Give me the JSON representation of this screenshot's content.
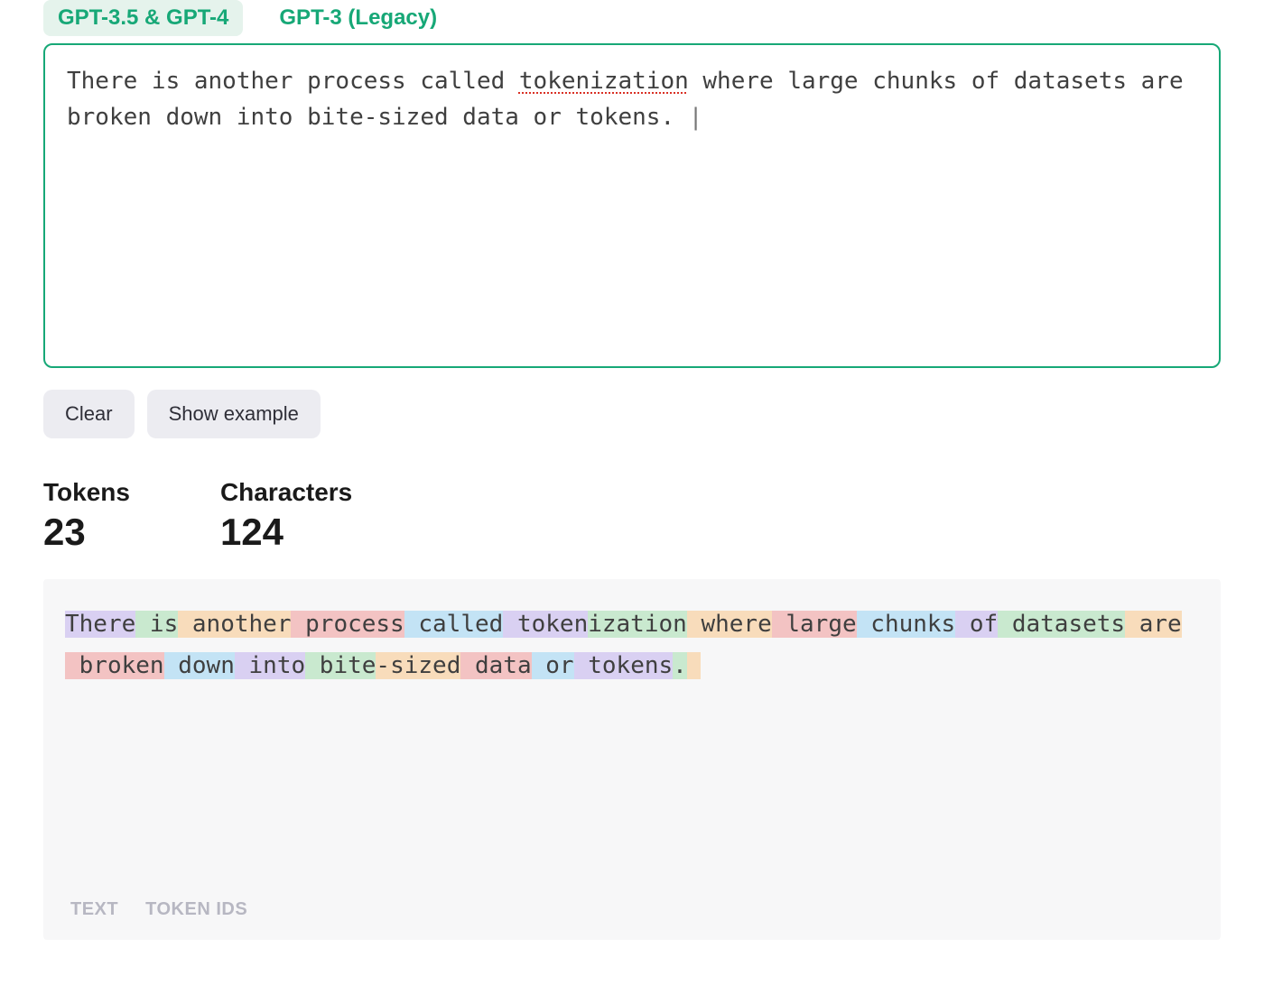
{
  "tabs": {
    "active": "GPT-3.5 & GPT-4",
    "inactive": "GPT-3 (Legacy)"
  },
  "input": {
    "parts": [
      {
        "text": "There is another process called ",
        "spell": false
      },
      {
        "text": "tokenization",
        "spell": true
      },
      {
        "text": " where large chunks of datasets are broken down into bite-sized data or tokens. ",
        "spell": false
      }
    ]
  },
  "buttons": {
    "clear": "Clear",
    "show_example": "Show example"
  },
  "stats": {
    "tokens_label": "Tokens",
    "tokens_value": "23",
    "characters_label": "Characters",
    "characters_value": "124"
  },
  "tokens": [
    {
      "text": "There",
      "color": "c0"
    },
    {
      "text": " is",
      "color": "c1"
    },
    {
      "text": " another",
      "color": "c2"
    },
    {
      "text": " process",
      "color": "c3"
    },
    {
      "text": " called",
      "color": "c4"
    },
    {
      "text": " token",
      "color": "c0"
    },
    {
      "text": "ization",
      "color": "c1"
    },
    {
      "text": " where",
      "color": "c2"
    },
    {
      "text": " large",
      "color": "c3"
    },
    {
      "text": " chunks",
      "color": "c4"
    },
    {
      "text": " of",
      "color": "c0"
    },
    {
      "text": " datasets",
      "color": "c1"
    },
    {
      "text": " are",
      "color": "c2"
    },
    {
      "text": " broken",
      "color": "c3"
    },
    {
      "text": " down",
      "color": "c4"
    },
    {
      "text": " into",
      "color": "c0"
    },
    {
      "text": " bite",
      "color": "c1"
    },
    {
      "text": "-sized",
      "color": "c2"
    },
    {
      "text": " data",
      "color": "c3"
    },
    {
      "text": " or",
      "color": "c4"
    },
    {
      "text": " tokens",
      "color": "c0"
    },
    {
      "text": ".",
      "color": "c1"
    },
    {
      "text": " ",
      "color": "c2"
    }
  ],
  "view_tabs": {
    "text": "TEXT",
    "ids": "TOKEN IDS"
  }
}
